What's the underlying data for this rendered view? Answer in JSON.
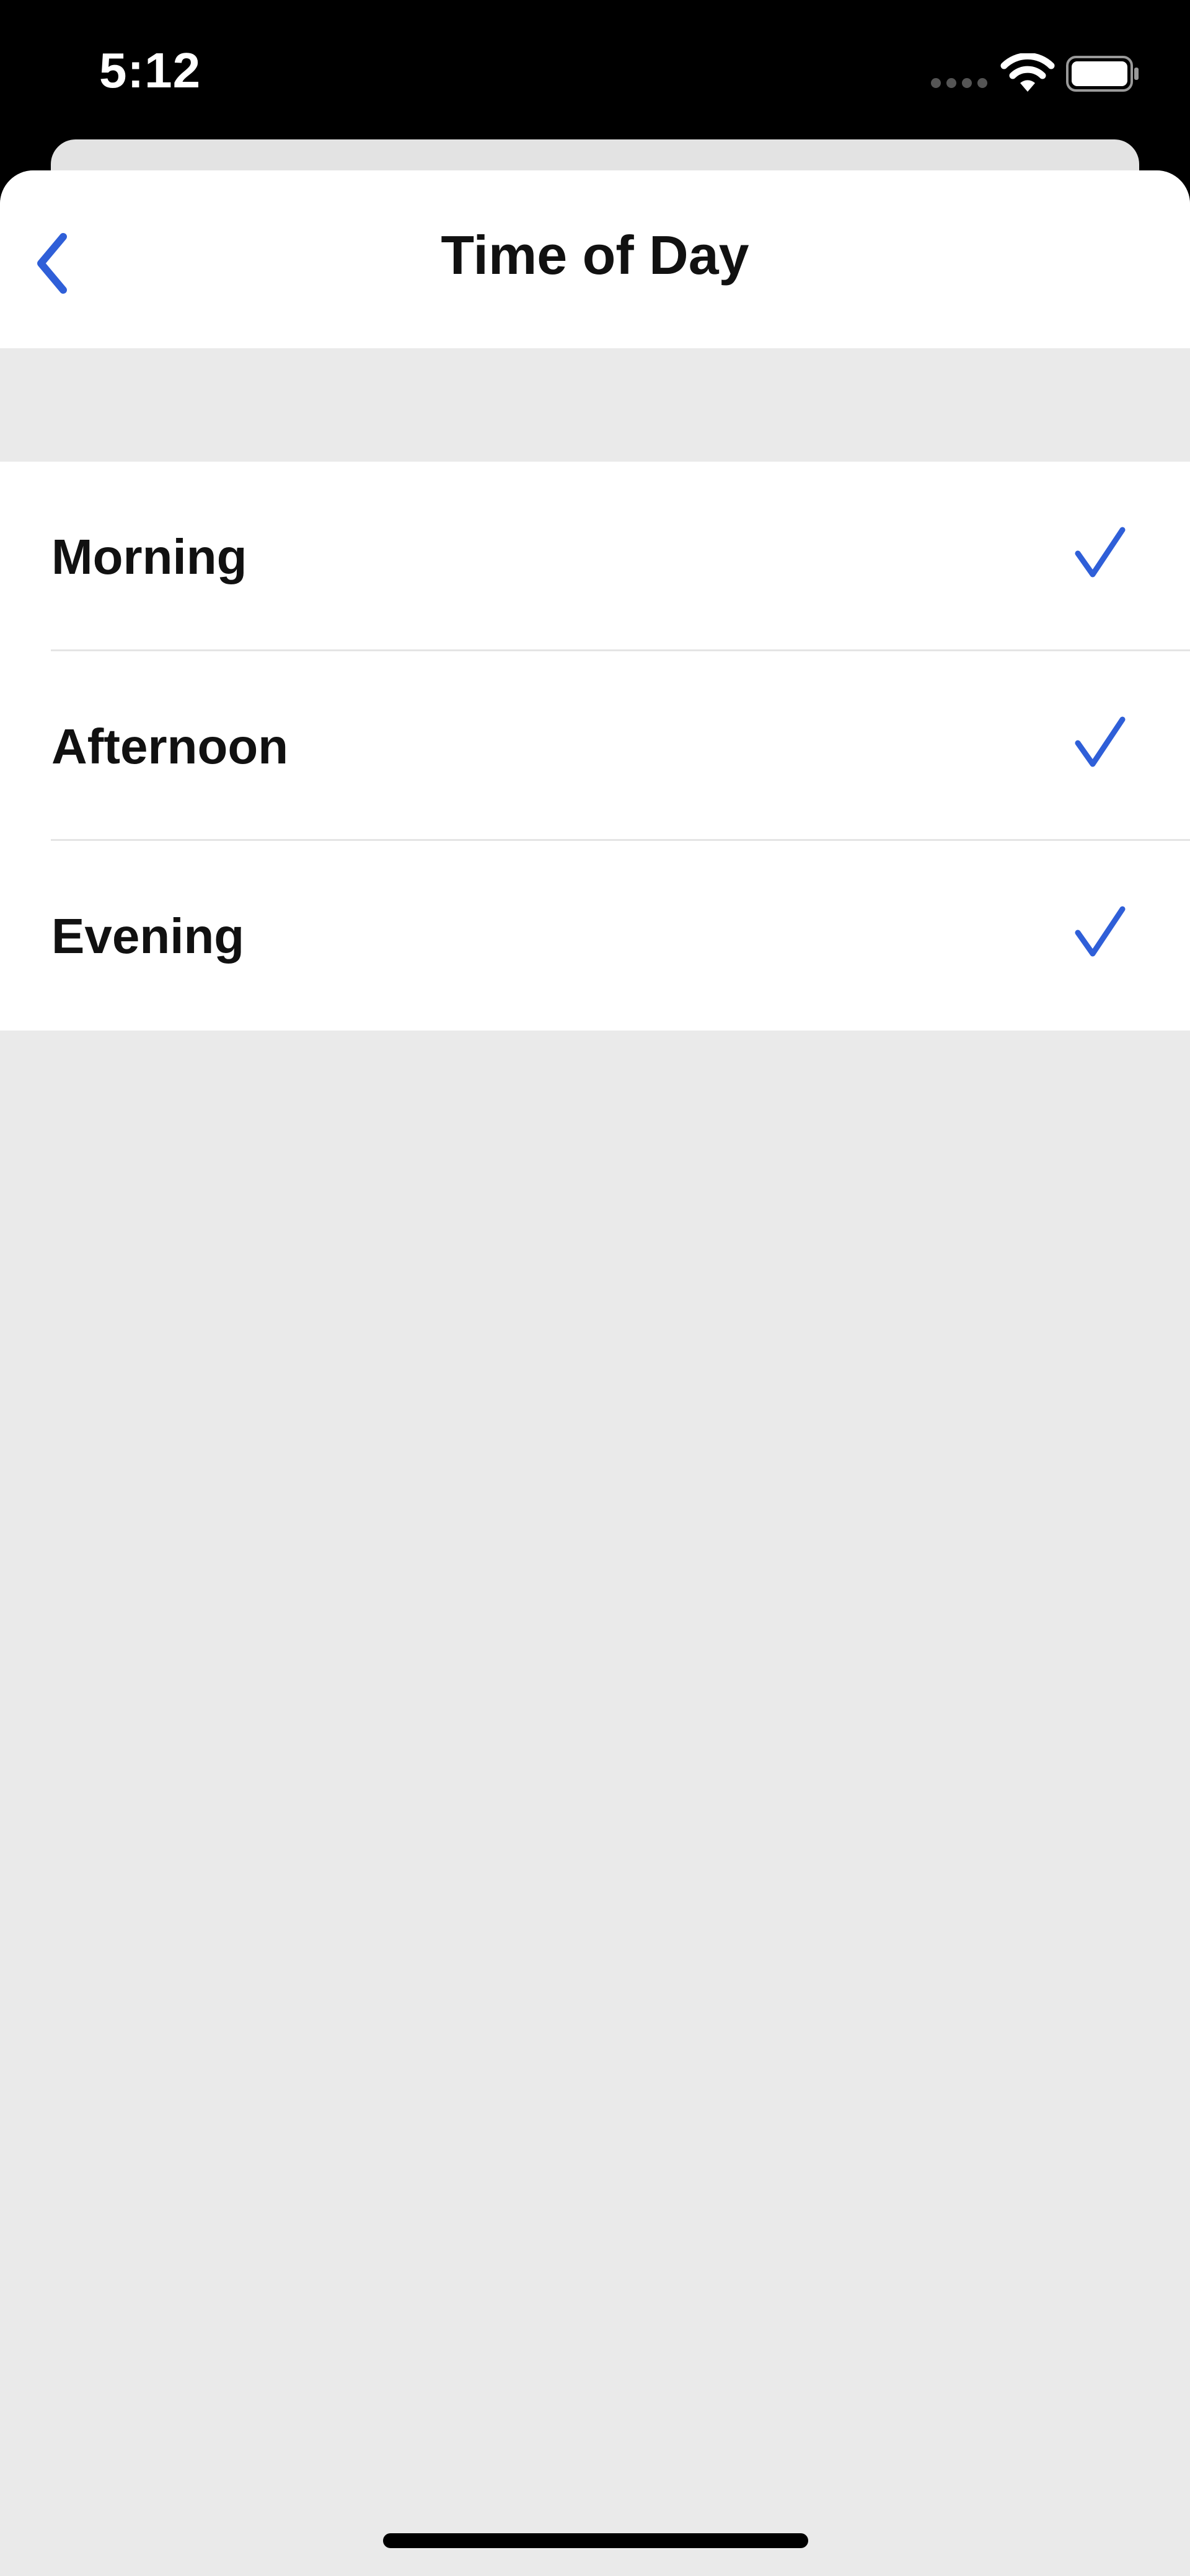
{
  "status_bar": {
    "time": "5:12",
    "icons": [
      "signal-dots-icon",
      "wifi-icon",
      "battery-icon"
    ]
  },
  "nav": {
    "title": "Time of Day",
    "back_icon": "chevron-left-icon"
  },
  "options": [
    {
      "label": "Morning",
      "selected": true,
      "icon": "checkmark-icon"
    },
    {
      "label": "Afternoon",
      "selected": true,
      "icon": "checkmark-icon"
    },
    {
      "label": "Evening",
      "selected": true,
      "icon": "checkmark-icon"
    }
  ],
  "colors": {
    "accent": "#2f5fd8",
    "background": "#eaeaea",
    "surface": "#ffffff",
    "text": "#111111",
    "status_bar": "#000000"
  }
}
